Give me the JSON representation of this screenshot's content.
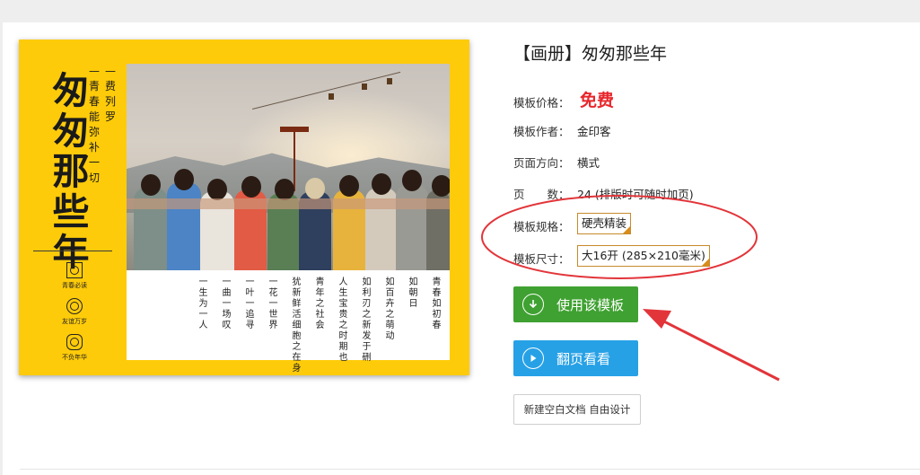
{
  "template": {
    "title": "【画册】匆匆那些年"
  },
  "cover": {
    "main_title": "匆匆那些年",
    "subtitle_lines": [
      "—费列罗",
      "—青春能弥补一切"
    ],
    "badges": [
      "青春必读",
      "友谊万岁",
      "不负年华"
    ],
    "poem_columns": [
      "一生为一人",
      "一曲一场叹",
      "一叶一追寻",
      "一花一世界",
      "犹新鲜活细胞之在身",
      "青年之社会",
      "人生宝贵之时期也",
      "如利刃之新发于硎",
      "如百卉之萌动",
      "如朝日",
      "青春如初春"
    ]
  },
  "info": {
    "price": {
      "label": "模板价格：",
      "value": "免费"
    },
    "author": {
      "label": "模板作者：",
      "value": "金印客"
    },
    "orientation": {
      "label": "页面方向：",
      "value": "横式"
    },
    "pages": {
      "label": "页　　数：",
      "value": "24 (排版时可随时加页)"
    },
    "spec": {
      "label": "模板规格：",
      "value": "硬壳精装"
    },
    "size": {
      "label": "模板尺寸：",
      "value": "大16开 (285×210毫米)"
    }
  },
  "buttons": {
    "use": "使用该模板",
    "flip": "翻页看看",
    "blank": "新建空白文档 自由设计"
  },
  "colors": {
    "cover_yellow": "#fecb0a",
    "price_red": "#e8262b",
    "use_green": "#3fa131",
    "flip_blue": "#27a1e6",
    "annotation_red": "#e2353a"
  }
}
